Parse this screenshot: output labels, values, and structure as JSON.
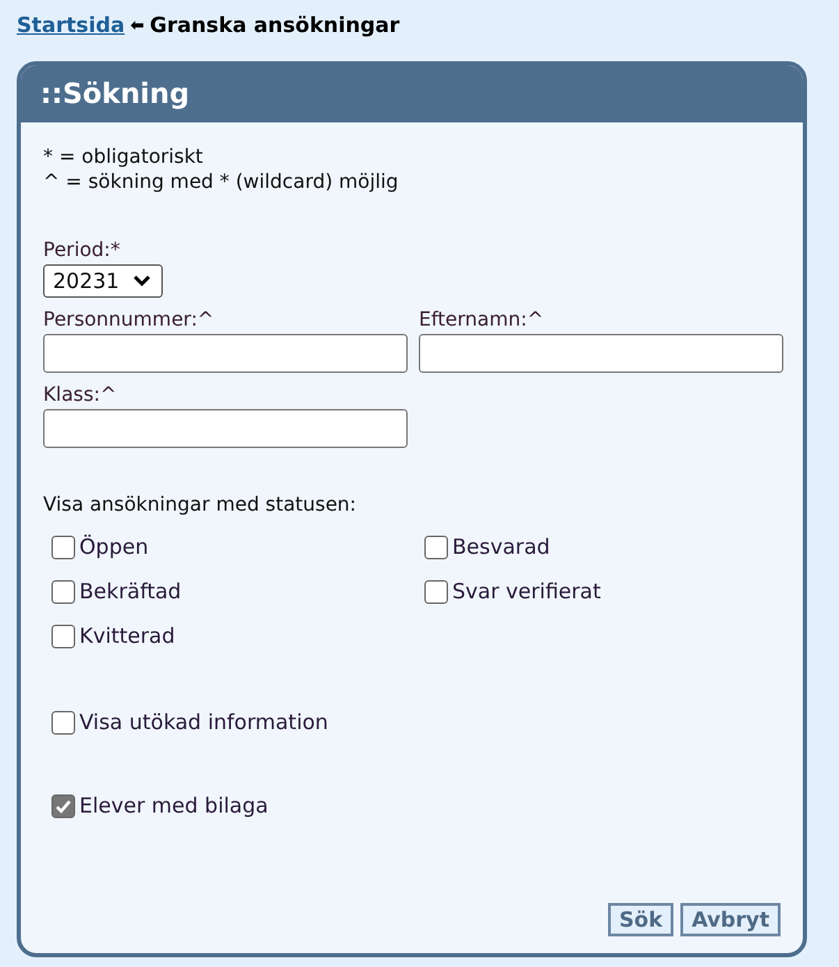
{
  "breadcrumb": {
    "link": "Startsida",
    "separator": "⬅",
    "current": "Granska ansökningar"
  },
  "panel": {
    "title": "::Sökning",
    "legend": [
      "* = obligatoriskt",
      "^ = sökning med * (wildcard) möjlig"
    ],
    "period": {
      "label": "Period:*",
      "value": "20231"
    },
    "fields": [
      {
        "label": "Personnummer:^"
      },
      {
        "label": "Efternamn:^"
      },
      {
        "label": "Klass:^"
      }
    ],
    "status_heading": "Visa ansökningar med statusen:",
    "statuses": [
      {
        "label": "Öppen",
        "checked": false
      },
      {
        "label": "Besvarad",
        "checked": false
      },
      {
        "label": "Bekräftad",
        "checked": false
      },
      {
        "label": "Svar verifierat",
        "checked": false
      },
      {
        "label": "Kvitterad",
        "checked": false
      }
    ],
    "extended": {
      "label": "Visa utökad information",
      "checked": false
    },
    "attachment": {
      "label": "Elever med bilaga",
      "checked": true
    },
    "buttons": [
      "Sök",
      "Avbryt"
    ]
  }
}
